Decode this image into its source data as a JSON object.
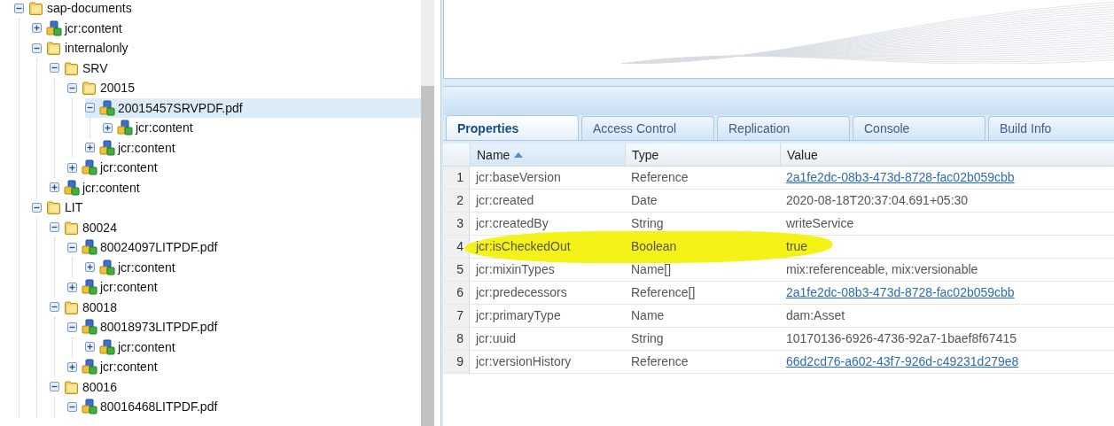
{
  "tree": [
    {
      "kind": "folder",
      "label": "sap-documents",
      "expanded": true,
      "selected": false,
      "children": [
        {
          "kind": "node",
          "label": "jcr:content",
          "expanded": false,
          "selected": false
        },
        {
          "kind": "folder",
          "label": "internalonly",
          "expanded": true,
          "selected": false,
          "children": [
            {
              "kind": "folder",
              "label": "SRV",
              "expanded": true,
              "selected": false,
              "children": [
                {
                  "kind": "folder",
                  "label": "20015",
                  "expanded": true,
                  "selected": false,
                  "children": [
                    {
                      "kind": "node",
                      "label": "20015457SRVPDF.pdf",
                      "expanded": true,
                      "selected": true,
                      "children": [
                        {
                          "kind": "node",
                          "label": "jcr:content",
                          "expanded": false,
                          "selected": false
                        }
                      ]
                    },
                    {
                      "kind": "node",
                      "label": "jcr:content",
                      "expanded": false,
                      "selected": false
                    }
                  ]
                },
                {
                  "kind": "node",
                  "label": "jcr:content",
                  "expanded": false,
                  "selected": false
                }
              ]
            },
            {
              "kind": "node",
              "label": "jcr:content",
              "expanded": false,
              "selected": false
            }
          ]
        },
        {
          "kind": "folder",
          "label": "LIT",
          "expanded": true,
          "selected": false,
          "children": [
            {
              "kind": "folder",
              "label": "80024",
              "expanded": true,
              "selected": false,
              "children": [
                {
                  "kind": "node",
                  "label": "80024097LITPDF.pdf",
                  "expanded": true,
                  "selected": false,
                  "children": [
                    {
                      "kind": "node",
                      "label": "jcr:content",
                      "expanded": false,
                      "selected": false
                    }
                  ]
                },
                {
                  "kind": "node",
                  "label": "jcr:content",
                  "expanded": false,
                  "selected": false
                }
              ]
            },
            {
              "kind": "folder",
              "label": "80018",
              "expanded": true,
              "selected": false,
              "children": [
                {
                  "kind": "node",
                  "label": "80018973LITPDF.pdf",
                  "expanded": true,
                  "selected": false,
                  "children": [
                    {
                      "kind": "node",
                      "label": "jcr:content",
                      "expanded": false,
                      "selected": false
                    }
                  ]
                },
                {
                  "kind": "node",
                  "label": "jcr:content",
                  "expanded": false,
                  "selected": false
                }
              ]
            },
            {
              "kind": "folder",
              "label": "80016",
              "expanded": true,
              "selected": false,
              "children": [
                {
                  "kind": "node",
                  "label": "80016468LITPDF.pdf",
                  "expanded": true,
                  "selected": false
                }
              ]
            }
          ]
        }
      ]
    }
  ],
  "tabs": [
    {
      "label": "Properties",
      "selected": true
    },
    {
      "label": "Access Control",
      "selected": false
    },
    {
      "label": "Replication",
      "selected": false
    },
    {
      "label": "Console",
      "selected": false
    },
    {
      "label": "Build Info",
      "selected": false
    }
  ],
  "table": {
    "columns": [
      {
        "label": "Name",
        "sorted": true
      },
      {
        "label": "Type",
        "sorted": false
      },
      {
        "label": "Value",
        "sorted": false
      }
    ],
    "rows": [
      {
        "number": "1",
        "name": "jcr:baseVersion",
        "type": "Reference",
        "value": "2a1fe2dc-08b3-473d-8728-fac02b059cbb",
        "value_is_link": true,
        "highlighted": false
      },
      {
        "number": "2",
        "name": "jcr:created",
        "type": "Date",
        "value": "2020-08-18T20:37:04.691+05:30",
        "value_is_link": false,
        "highlighted": false
      },
      {
        "number": "3",
        "name": "jcr:createdBy",
        "type": "String",
        "value": "writeService",
        "value_is_link": false,
        "highlighted": false
      },
      {
        "number": "4",
        "name": "jcr:isCheckedOut",
        "type": "Boolean",
        "value": "true",
        "value_is_link": false,
        "highlighted": true
      },
      {
        "number": "5",
        "name": "jcr:mixinTypes",
        "type": "Name[]",
        "value": "mix:referenceable, mix:versionable",
        "value_is_link": false,
        "highlighted": false
      },
      {
        "number": "6",
        "name": "jcr:predecessors",
        "type": "Reference[]",
        "value": "2a1fe2dc-08b3-473d-8728-fac02b059cbb",
        "value_is_link": true,
        "highlighted": false
      },
      {
        "number": "7",
        "name": "jcr:primaryType",
        "type": "Name",
        "value": "dam:Asset",
        "value_is_link": false,
        "highlighted": false
      },
      {
        "number": "8",
        "name": "jcr:uuid",
        "type": "String",
        "value": "10170136-6926-4736-92a7-1baef8f67415",
        "value_is_link": false,
        "highlighted": false
      },
      {
        "number": "9",
        "name": "jcr:versionHistory",
        "type": "Reference",
        "value": "66d2cd76-a602-43f7-926d-c49231d279e8",
        "value_is_link": true,
        "highlighted": false
      }
    ]
  }
}
